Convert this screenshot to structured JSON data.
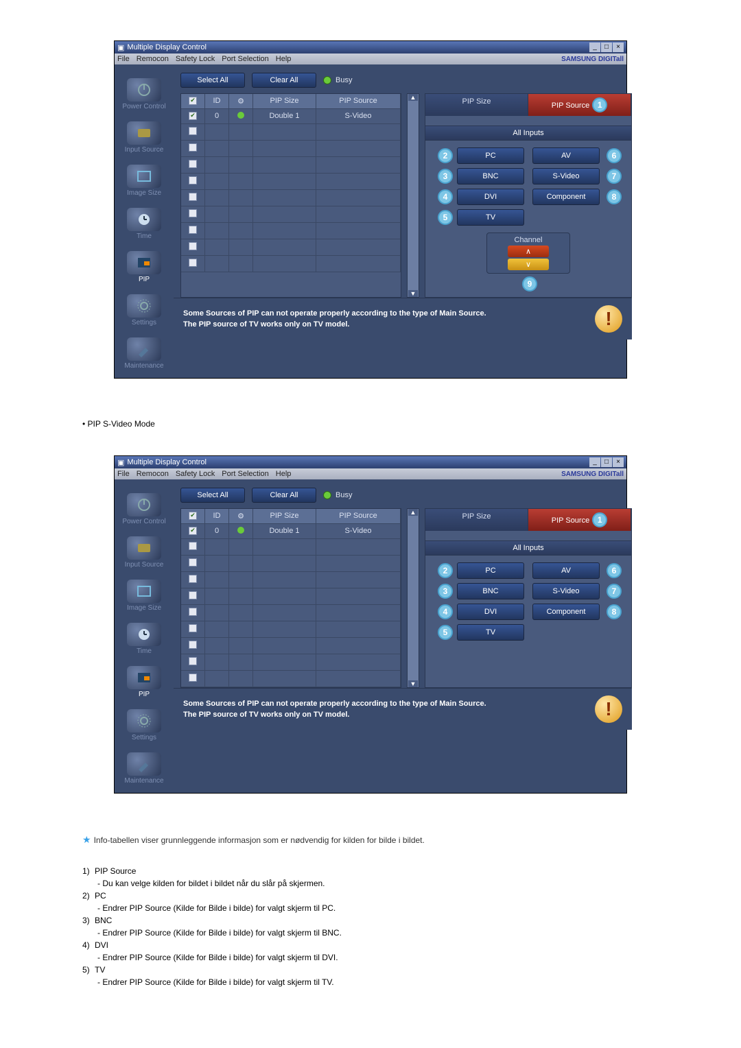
{
  "window": {
    "title": "Multiple Display Control",
    "menu": [
      "File",
      "Remocon",
      "Safety Lock",
      "Port Selection",
      "Help"
    ],
    "brand": "SAMSUNG DIGITall"
  },
  "sidebar": {
    "items": [
      {
        "label": "Power Control"
      },
      {
        "label": "Input Source"
      },
      {
        "label": "Image Size"
      },
      {
        "label": "Time"
      },
      {
        "label": "PIP"
      },
      {
        "label": "Settings"
      },
      {
        "label": "Maintenance"
      }
    ]
  },
  "toolbar": {
    "select_all": "Select All",
    "clear_all": "Clear All",
    "busy_label": "Busy"
  },
  "table": {
    "headers": {
      "id": "ID",
      "pip_size": "PIP Size",
      "pip_source": "PIP Source"
    },
    "row0": {
      "id": "0",
      "pip_size": "Double 1",
      "pip_source": "S-Video"
    }
  },
  "tabs": {
    "pip_size": "PIP Size",
    "pip_source": "PIP Source"
  },
  "all_inputs": "All Inputs",
  "sources": {
    "pc": "PC",
    "bnc": "BNC",
    "dvi": "DVI",
    "tv": "TV",
    "av": "AV",
    "svideo": "S-Video",
    "component": "Component"
  },
  "channel": {
    "label": "Channel"
  },
  "footer": {
    "line1": "Some Sources of PIP can not operate properly according to the type of Main Source.",
    "line2": "The PIP source of TV works only on TV model."
  },
  "callouts": {
    "c1": "1",
    "c2": "2",
    "c3": "3",
    "c4": "4",
    "c5": "5",
    "c6": "6",
    "c7": "7",
    "c8": "8",
    "c9": "9"
  },
  "doc": {
    "section_heading": "PIP S-Video Mode",
    "info_line": "Info-tabellen viser grunnleggende informasjon som er nødvendig for kilden for bilde i bildet.",
    "items": [
      {
        "n": "1)",
        "t": "PIP Source",
        "s": "- Du kan velge kilden for bildet i bildet når du slår på skjermen."
      },
      {
        "n": "2)",
        "t": "PC",
        "s": "- Endrer PIP Source (Kilde for Bilde i bilde) for valgt skjerm til PC."
      },
      {
        "n": "3)",
        "t": "BNC",
        "s": "- Endrer PIP Source (Kilde for Bilde i bilde) for valgt skjerm til BNC."
      },
      {
        "n": "4)",
        "t": "DVI",
        "s": "- Endrer PIP Source (Kilde for Bilde i bilde) for valgt skjerm til DVI."
      },
      {
        "n": "5)",
        "t": "TV",
        "s": "- Endrer PIP Source (Kilde for Bilde i bilde) for valgt skjerm til TV."
      }
    ]
  }
}
